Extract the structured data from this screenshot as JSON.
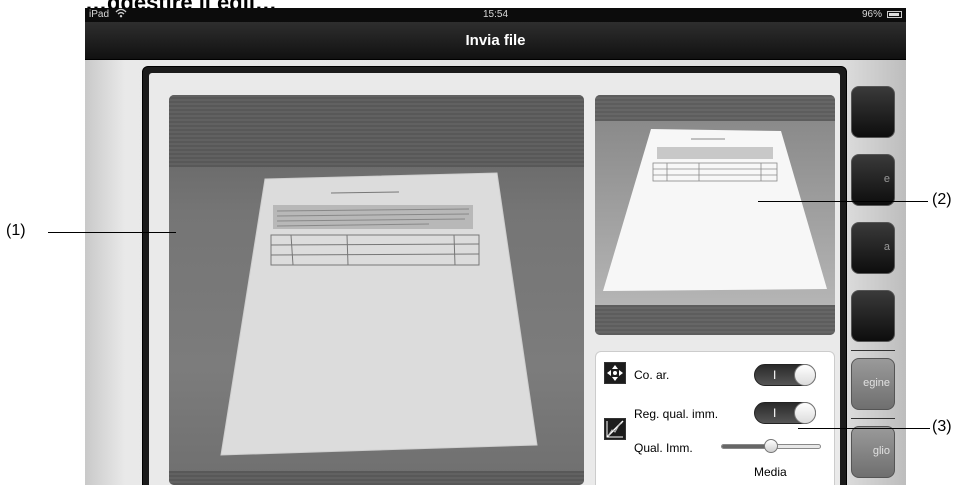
{
  "page_heading": "…ggestire li egli…",
  "status_bar": {
    "carrier": "iPad",
    "wifi_icon": "wifi-icon",
    "time": "15:54",
    "battery": "96%",
    "battery_icon": "battery-icon"
  },
  "nav_bar": {
    "title": "Invia file"
  },
  "side_buttons": [
    "",
    "e",
    "a",
    "",
    "egine",
    "glio"
  ],
  "control_panel": {
    "auto_correction_icon": "perspective-correction-icon",
    "auto_correction_label": "Co. ar.",
    "auto_correction_state": "I",
    "image_quality_icon": "image-quality-icon",
    "image_quality_adjust_label": "Reg. qual. imm.",
    "image_quality_adjust_state": "I",
    "image_quality_label": "Qual. Imm.",
    "image_quality_value_label": "Media",
    "image_quality_level": 0.5
  },
  "callouts": {
    "main_preview": "(1)",
    "thumbnail": "(2)",
    "settings": "(3)"
  },
  "colors": {
    "nav_bar": "#1a1a1a",
    "modal_frame": "#1b1b1b",
    "toggle_on": "#333333"
  }
}
